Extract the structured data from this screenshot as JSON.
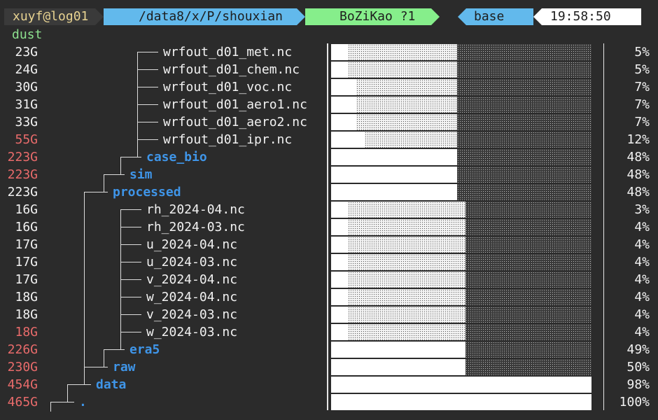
{
  "prompt": {
    "user_host": "xuyf@log01",
    "path": "/data8/x/P/shouxian",
    "git": "BoZiKao ?1",
    "env": "base",
    "time": "19:58:50"
  },
  "root_dir": "dust",
  "entries": [
    {
      "size": "23G",
      "name": "wrfout_d01_met.nc",
      "pct": "5%"
    },
    {
      "size": "24G",
      "name": "wrfout_d01_chem.nc",
      "pct": "5%"
    },
    {
      "size": "30G",
      "name": "wrfout_d01_voc.nc",
      "pct": "7%"
    },
    {
      "size": "31G",
      "name": "wrfout_d01_aero1.nc",
      "pct": "7%"
    },
    {
      "size": "33G",
      "name": "wrfout_d01_aero2.nc",
      "pct": "7%"
    },
    {
      "size": "55G",
      "name": "wrfout_d01_ipr.nc",
      "pct": "12%"
    },
    {
      "size": "223G",
      "name": "case_bio",
      "pct": "48%"
    },
    {
      "size": "223G",
      "name": "sim",
      "pct": "48%"
    },
    {
      "size": "223G",
      "name": "processed",
      "pct": "48%"
    },
    {
      "size": "16G",
      "name": "rh_2024-04.nc",
      "pct": "3%"
    },
    {
      "size": "16G",
      "name": "rh_2024-03.nc",
      "pct": "4%"
    },
    {
      "size": "17G",
      "name": "u_2024-04.nc",
      "pct": "4%"
    },
    {
      "size": "17G",
      "name": "u_2024-03.nc",
      "pct": "4%"
    },
    {
      "size": "17G",
      "name": "v_2024-04.nc",
      "pct": "4%"
    },
    {
      "size": "18G",
      "name": "w_2024-04.nc",
      "pct": "4%"
    },
    {
      "size": "18G",
      "name": "v_2024-03.nc",
      "pct": "4%"
    },
    {
      "size": "18G",
      "name": "w_2024-03.nc",
      "pct": "4%"
    },
    {
      "size": "226G",
      "name": "era5",
      "pct": "49%"
    },
    {
      "size": "230G",
      "name": "raw",
      "pct": "50%"
    },
    {
      "size": "454G",
      "name": "data",
      "pct": "98%"
    },
    {
      "size": "465G",
      "name": ".",
      "pct": "100%"
    }
  ],
  "colors": {
    "background": "#2b2b2b",
    "directory": "#3f95e8",
    "large_size": "#e96b6b",
    "root_dir": "#8ce08e",
    "prompt_user": "#e8d391",
    "prompt_path_bg": "#62b9ec",
    "prompt_git_bg": "#86ee8b"
  }
}
